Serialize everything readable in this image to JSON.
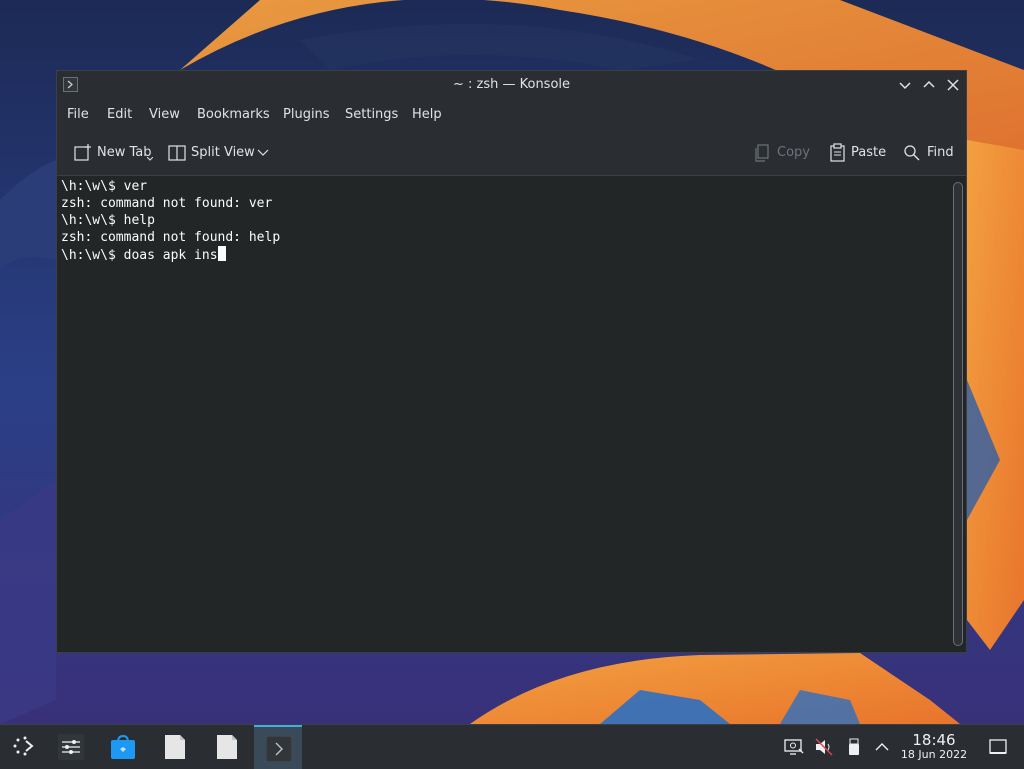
{
  "window": {
    "title": "~ : zsh — Konsole"
  },
  "menu": [
    "File",
    "Edit",
    "View",
    "Bookmarks",
    "Plugins",
    "Settings",
    "Help"
  ],
  "toolbar": {
    "new_tab": "New Tab",
    "split_view": "Split View",
    "copy": "Copy",
    "paste": "Paste",
    "find": "Find"
  },
  "terminal": {
    "lines": [
      "\\h:\\w\\$ ver",
      "zsh: command not found: ver",
      "\\h:\\w\\$ help",
      "zsh: command not found: help",
      "\\h:\\w\\$ doas apk ins"
    ]
  },
  "taskbar": {
    "time": "18:46",
    "date": "18 Jun 2022",
    "items": [
      "app-launcher-icon",
      "system-settings-icon",
      "discover-store-icon",
      "file-icon",
      "file-icon",
      "konsole-icon"
    ]
  },
  "colors": {
    "accent": "#3daee9",
    "terminal_bg": "#232627",
    "chrome_bg": "#2a2e32"
  }
}
